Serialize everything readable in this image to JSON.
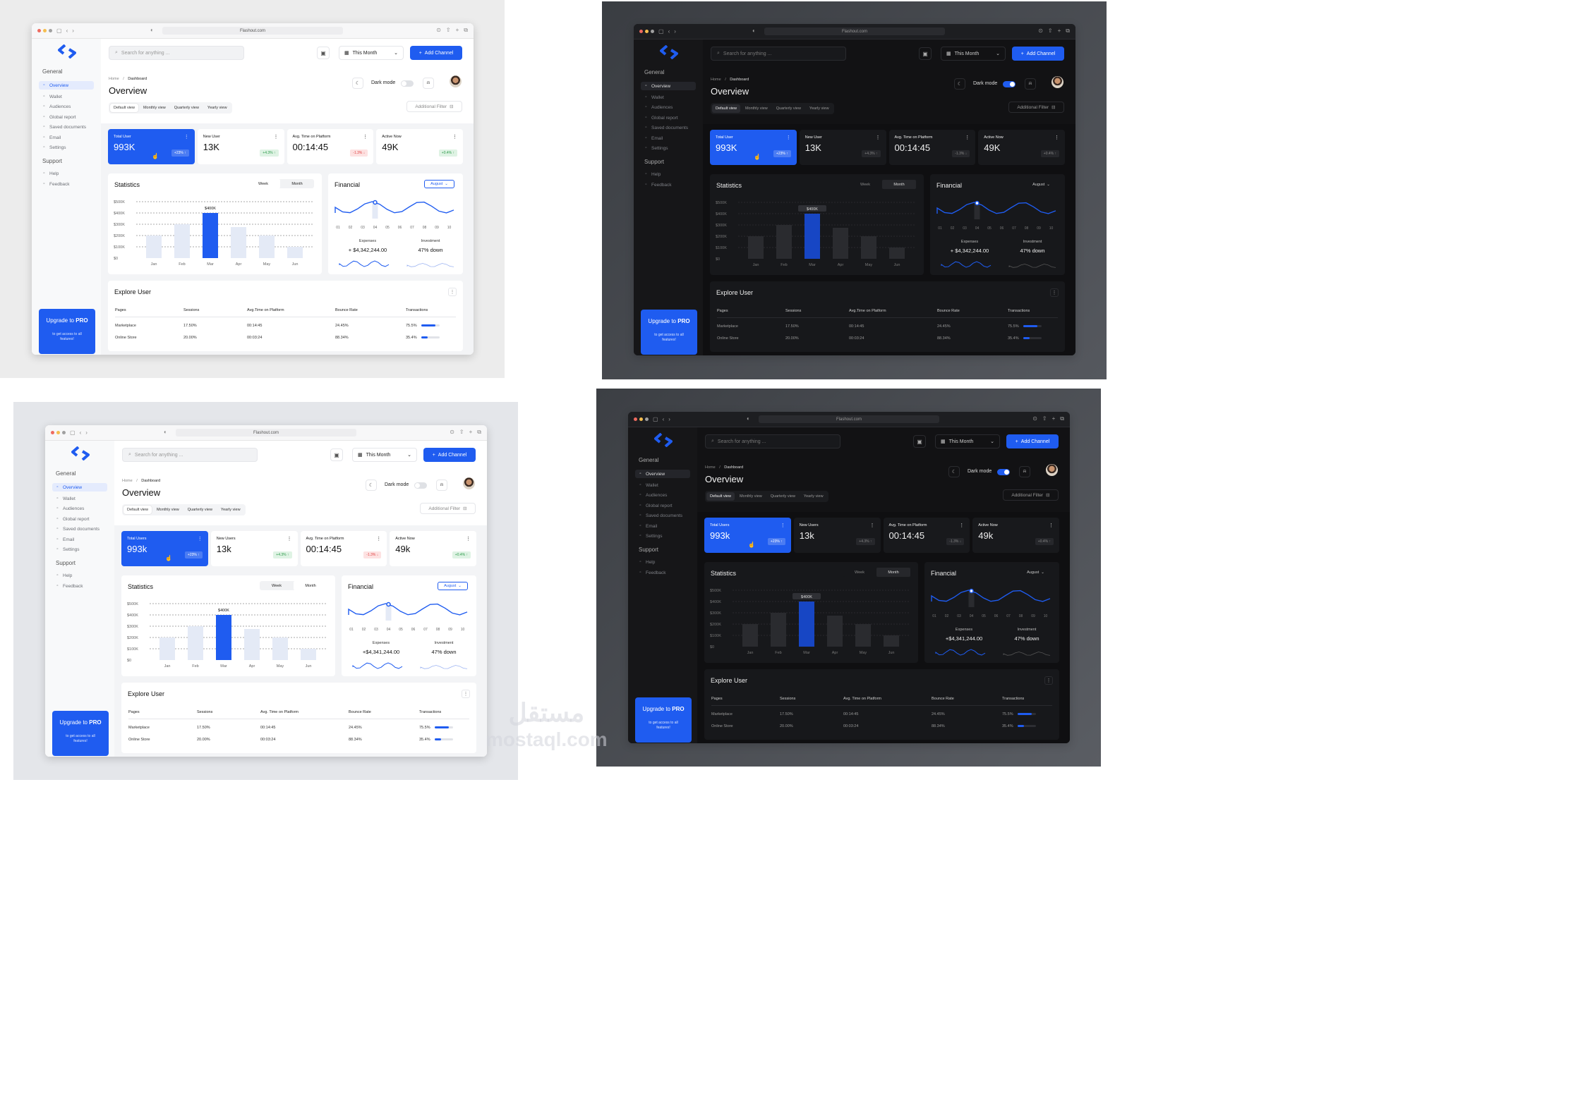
{
  "browser": {
    "url": "Flashout.com"
  },
  "sidebar": {
    "general_label": "General",
    "items": [
      {
        "label": "Overview",
        "icon": "grid-icon"
      },
      {
        "label": "Wallet",
        "icon": "wallet-icon"
      },
      {
        "label": "Audiences",
        "icon": "users-icon"
      },
      {
        "label": "Global report",
        "icon": "globe-icon"
      },
      {
        "label": "Saved documents",
        "icon": "bookmark-icon"
      },
      {
        "label": "Email",
        "icon": "mail-icon"
      },
      {
        "label": "Settings",
        "icon": "gear-icon"
      }
    ],
    "support_label": "Support",
    "support_items": [
      {
        "label": "Help",
        "icon": "help-icon"
      },
      {
        "label": "Feedback",
        "icon": "feedback-icon"
      }
    ],
    "upgrade": {
      "title_prefix": "Upgrade to ",
      "title_bold": "PRO",
      "subtitle": "to get access to all features!"
    }
  },
  "topbar": {
    "search_placeholder": "Search for anything ...",
    "period": "This Month",
    "add_channel": "Add Channel"
  },
  "header": {
    "breadcrumb_home": "Home",
    "breadcrumb_sep": "/",
    "breadcrumb_current": "Dashboard",
    "title": "Overview",
    "dark_mode_label": "Dark mode",
    "views": [
      "Default view",
      "Monthly view",
      "Quarterly view",
      "Yearly view"
    ],
    "additional_filter": "Additional Filter"
  },
  "kpis": [
    {
      "label": "Total User",
      "value": "993K",
      "badge": "+23%",
      "badge_arrow": "↑",
      "trend": "up"
    },
    {
      "label": "New User",
      "value": "13K",
      "badge": "+4.3%",
      "badge_arrow": "↑",
      "trend": "up"
    },
    {
      "label": "Avg. Time on Platform",
      "value": "00:14:45",
      "badge": "-1.3%",
      "badge_arrow": "↓",
      "trend": "down"
    },
    {
      "label": "Active Now",
      "value": "49K",
      "badge": "+0.4%",
      "badge_arrow": "↑",
      "trend": "up"
    }
  ],
  "kpis_alt": [
    {
      "label": "Total Users",
      "value": "993k"
    },
    {
      "label": "New Users",
      "value": "13k"
    },
    {
      "label": "Avg. Time on Platform",
      "value": "00:14:45"
    },
    {
      "label": "Active Now",
      "value": "49k"
    }
  ],
  "statistics": {
    "title": "Statistics",
    "week": "Week",
    "month": "Month",
    "tooltip": "$400K"
  },
  "financial": {
    "title": "Financial",
    "month_select": "August",
    "x_ticks": [
      "01",
      "02",
      "03",
      "04",
      "05",
      "06",
      "07",
      "08",
      "09",
      "10"
    ],
    "expenses_label": "Expenses",
    "expenses_value": "+ $4,342,244.00",
    "expenses_value_alt": "+$4,341,244.00",
    "investment_label": "Investment",
    "investment_value": "47% down"
  },
  "explore": {
    "title": "Explore User",
    "columns": [
      "Pages",
      "Sessions",
      "Avg.Time on Platform",
      "Bounce Rate",
      "Transactions"
    ],
    "columns_alt": [
      "Pages",
      "Sessions",
      "Avg. Time on Platform",
      "Bounce Rate",
      "Transactions"
    ],
    "rows": [
      {
        "page": "Marketplace",
        "sessions": "17.50%",
        "avg_time": "00:14:45",
        "bounce": "24.45%",
        "transactions": "75.5%",
        "progress": 0.755
      },
      {
        "page": "Online Store",
        "sessions": "20.00%",
        "avg_time": "00:03:24",
        "bounce": "88.34%",
        "transactions": "35.4%",
        "progress": 0.354
      }
    ]
  },
  "chart_data": {
    "type": "bar",
    "categories": [
      "Jan",
      "Feb",
      "Mar",
      "Apr",
      "May",
      "Jun"
    ],
    "values": [
      200,
      300,
      400,
      275,
      200,
      100
    ],
    "highlight_index": 2,
    "y_ticks": [
      "$500K",
      "$400K",
      "$300K",
      "$200K",
      "$100K",
      "$0"
    ],
    "ylim": [
      0,
      500
    ],
    "financial_line": {
      "x": [
        "01",
        "02",
        "03",
        "04",
        "05",
        "06",
        "07",
        "08",
        "09",
        "10"
      ],
      "marker_x": "04"
    }
  },
  "watermark": {
    "arabic": "مستقل",
    "latin": "mostaql.com"
  },
  "colors": {
    "accent": "#1f5cf0",
    "up": "#2c9a4a",
    "down": "#e04444"
  }
}
